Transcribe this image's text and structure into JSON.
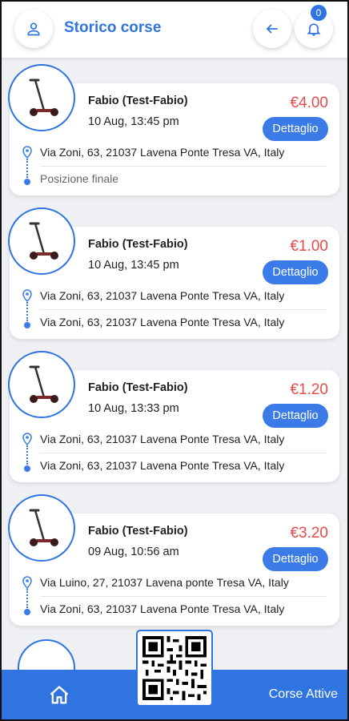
{
  "header": {
    "title": "Storico corse",
    "notification_count": "0"
  },
  "rides": [
    {
      "user": "Fabio (Test-Fabio)",
      "datetime": "10 Aug, 13:45 pm",
      "price": "€4.00",
      "detail_label": "Dettaglio",
      "start": "Via Zoni, 63, 21037 Lavena Ponte Tresa VA, Italy",
      "end": "Posizione finale"
    },
    {
      "user": "Fabio (Test-Fabio)",
      "datetime": "10 Aug, 13:45 pm",
      "price": "€1.00",
      "detail_label": "Dettaglio",
      "start": "Via Zoni, 63, 21037 Lavena Ponte Tresa VA, Italy",
      "end": "Via Zoni, 63, 21037 Lavena Ponte Tresa VA, Italy"
    },
    {
      "user": "Fabio (Test-Fabio)",
      "datetime": "10 Aug, 13:33 pm",
      "price": "€1.20",
      "detail_label": "Dettaglio",
      "start": "Via Zoni, 63, 21037 Lavena Ponte Tresa VA, Italy",
      "end": "Via Zoni, 63, 21037 Lavena Ponte Tresa VA, Italy"
    },
    {
      "user": "Fabio (Test-Fabio)",
      "datetime": "09 Aug, 10:56 am",
      "price": "€3.20",
      "detail_label": "Dettaglio",
      "start": "Via Luino, 27, 21037 Lavena ponte Tresa VA, Italy",
      "end": "Via Zoni, 63, 21037 Lavena Ponte Tresa VA, Italy"
    }
  ],
  "bottom_nav": {
    "active_rides_label": "Corse Attive"
  },
  "icons": {
    "profile": "user-icon",
    "back": "arrow-left-icon",
    "notifications": "bell-icon",
    "home": "home-icon",
    "qr": "qr-code-icon",
    "vehicle": "scooter-icon",
    "pin": "location-pin-icon"
  },
  "colors": {
    "accent": "#2f74e0",
    "price": "#e84a4a",
    "background": "#eef0f3"
  }
}
